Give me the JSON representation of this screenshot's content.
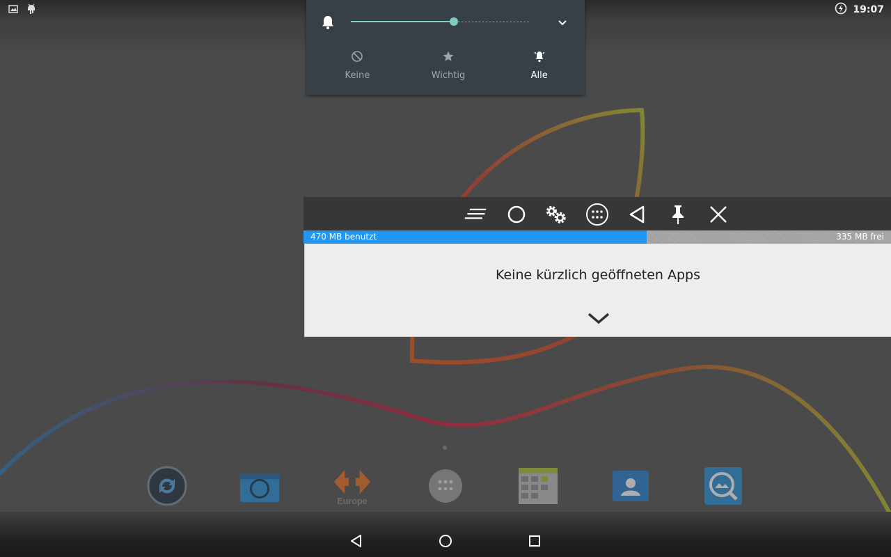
{
  "status_bar": {
    "time": "19:07",
    "left_icons": [
      "image-icon",
      "android-icon"
    ],
    "right_icons": [
      "battery-charging-icon"
    ]
  },
  "volume_panel": {
    "level_percent": 58,
    "modes": [
      {
        "label": "Keine",
        "icon": "do-not-disturb-icon",
        "active": false
      },
      {
        "label": "Wichtig",
        "icon": "star-icon",
        "active": false
      },
      {
        "label": "Alle",
        "icon": "bell-ringing-icon",
        "active": true
      }
    ],
    "accent": "#80cbc4"
  },
  "recents": {
    "toolbar_icons": [
      "sort-lines-icon",
      "home-circle-icon",
      "gears-icon",
      "app-drawer-icon",
      "back-triangle-icon",
      "pin-icon",
      "close-icon"
    ],
    "memory": {
      "used_label": "470 MB benutzt",
      "free_label": "335 MB frei",
      "used_fraction": 0.584,
      "used_color": "#2196f3"
    },
    "empty_message": "Keine kürzlich geöffneten Apps"
  },
  "dock": {
    "apps": [
      "sync-app-icon",
      "camera-app-icon",
      "europe-app-icon",
      "launcher-app-icon",
      "calendar-app-icon",
      "contacts-app-icon",
      "gallery-app-icon"
    ]
  },
  "nav_bar": {
    "buttons": [
      "back-icon",
      "home-icon",
      "overview-icon"
    ]
  }
}
